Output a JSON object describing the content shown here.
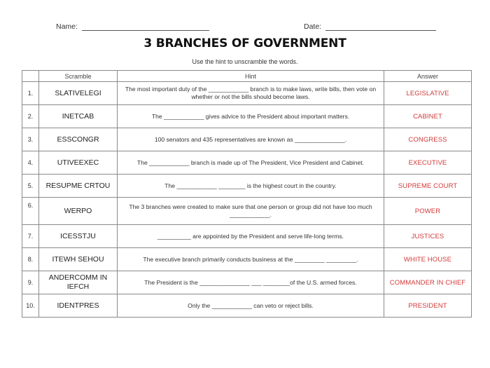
{
  "header": {
    "name_label": "Name:",
    "date_label": "Date:"
  },
  "title": "3 BRANCHES OF GOVERNMENT",
  "instructions": "Use the hint to unscramble the words.",
  "table": {
    "columns": {
      "number": "",
      "scramble": "Scramble",
      "hint": "Hint",
      "answer": "Answer"
    },
    "rows": [
      {
        "number": "1.",
        "scramble": "SLATIVELEGI",
        "hint": "The most important duty of the ____________ branch is to make laws, write bills, then vote on whether or not the bills should become laws.",
        "answer": "LEGISLATIVE"
      },
      {
        "number": "2.",
        "scramble": "INETCAB",
        "hint": "The ____________ gives advice to the President about important matters.",
        "answer": "CABINET"
      },
      {
        "number": "3.",
        "scramble": "ESSCONGR",
        "hint": "100 senators and 435 representatives are known as _______________.",
        "answer": "CONGRESS"
      },
      {
        "number": "4.",
        "scramble": "UTIVEEXEC",
        "hint": "The ____________ branch is made up of The President, Vice President and Cabinet.",
        "answer": "EXECUTIVE"
      },
      {
        "number": "5.",
        "scramble": "RESUPME CRTOU",
        "hint": "The ____________ ________ is the highest court in the country.",
        "answer": "SUPREME COURT"
      },
      {
        "number": "6.",
        "scramble": "WERPO",
        "hint": "The 3 branches were created to make sure that one person or group did not have too much ____________.",
        "answer": "POWER"
      },
      {
        "number": "7.",
        "scramble": "ICESSTJU",
        "hint": "__________ are appointed by the President and serve life-long terms.",
        "answer": "JUSTICES"
      },
      {
        "number": "8.",
        "scramble": "ITEWH SEHOU",
        "hint": "The executive branch primarily conducts business at the _________ _________.",
        "answer": "WHITE HOUSE"
      },
      {
        "number": "9.",
        "scramble": "ANDERCOMM IN IEFCH",
        "hint": "The President is the _______________ ___ ________of the U.S. armed forces.",
        "answer": "COMMANDER IN CHIEF"
      },
      {
        "number": "10.",
        "scramble": "IDENTPRES",
        "hint": "Only the ____________ can veto or reject bills.",
        "answer": "PRESIDENT"
      }
    ]
  },
  "colors": {
    "answer_text": "#d23a3a",
    "border": "#8a8a8a"
  }
}
